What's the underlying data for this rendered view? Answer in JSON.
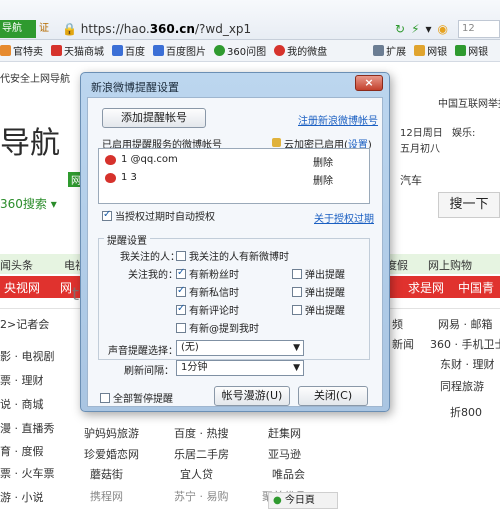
{
  "browser": {
    "tab_fragment": "导航",
    "cert_label": "证",
    "url_prefix": "https://hao.",
    "url_domain": "360.cn",
    "url_suffix": "/?wd_xp1",
    "search_hint": "12",
    "favorites": [
      {
        "label": "官特卖",
        "color": "#e68a2e"
      },
      {
        "label": "天猫商城",
        "color": "#d6332c"
      },
      {
        "label": "百度",
        "color": "#3b6fd6"
      },
      {
        "label": "百度图片",
        "color": "#3b6fd6"
      },
      {
        "label": "360问图",
        "color": "#2f9a2f"
      },
      {
        "label": "我的微盘",
        "color": "#d6332c"
      },
      {
        "label": "扩展",
        "color": "#6b7d93"
      },
      {
        "label": "网银",
        "color": "#e0a42e"
      },
      {
        "label": "网银",
        "color": "#2f9a2f"
      }
    ]
  },
  "page": {
    "top_left_text": "代安全上网导航",
    "logo_text": "导航",
    "right_top": "中国互联网举报",
    "date1": "12日周日",
    "date2": "五月初八",
    "yule": "娱乐:",
    "search_label": "360搜索",
    "search_button": "搜一下",
    "green_left": "网",
    "green_car": "汽车",
    "tab_left1": "闻头条",
    "tab_left2": "电视",
    "tab_right1": "度假",
    "tab_right2": "网上购物",
    "red_left": "央视网",
    "red_left2": "网",
    "red_right1": "求是网",
    "red_right2": "中国青年",
    "list_left": [
      "2>记者会",
      "影 · 电视剧",
      "票 · 理财",
      "说 · 商城",
      "漫 · 直播秀",
      "育 · 度假",
      "票 · 火车票",
      "游 · 小说"
    ],
    "list_right": [
      [
        "频",
        "网易 · 邮箱"
      ],
      [
        "新闻",
        "360 · 手机卫士"
      ],
      [
        "",
        "东财 · 理财"
      ],
      [
        "",
        "同程旅游"
      ],
      [
        "",
        "折800"
      ]
    ],
    "bottom_grid": [
      [
        "驴妈妈旅游",
        "百度 · 热搜",
        "赶集网"
      ],
      [
        "珍爱婚恋网",
        "乐居二手房",
        "亚马逊"
      ],
      [
        "蘑菇街",
        "宜人贷",
        "唯品会"
      ],
      [
        "携程网",
        "苏宁 · 易购",
        "聚美优品"
      ]
    ],
    "status_today": "今日頁"
  },
  "dialog": {
    "title": "新浪微博提醒设置",
    "close_label": "×",
    "add_button": "添加提醒帐号",
    "register_link": "注册新浪微博帐号",
    "enabled_label": "已启用提醒服务的微博帐号",
    "cloud_label": "云加密已启用(",
    "settings_link": "设置",
    "cloud_close": ")",
    "accounts": [
      {
        "name": "1           @qq.com",
        "delete": "删除"
      },
      {
        "name": "1           3",
        "delete": "删除"
      }
    ],
    "auto_auth": "当授权过期时自动授权",
    "about_auth_link": "关于授权过期",
    "group_title": "提醒设置",
    "row_follow_label": "我关注的人：",
    "row_follow_opt": "我关注的人有新微博时",
    "row_follow_me_label": "关注我的：",
    "opts": [
      {
        "label": "有新粉丝时",
        "popup": "弹出提醒"
      },
      {
        "label": "有新私信时",
        "popup": "弹出提醒"
      },
      {
        "label": "有新评论时",
        "popup": "弹出提醒"
      }
    ],
    "mention_opt": "有新@提到我时",
    "sound_label": "声音提醒选择：",
    "sound_value": "(无)",
    "refresh_label": "刷新间隔：",
    "refresh_value": "1分钟",
    "pause_all": "全部暂停提醒",
    "roam_button": "帐号漫游(U)",
    "close_button": "关闭(C)"
  }
}
